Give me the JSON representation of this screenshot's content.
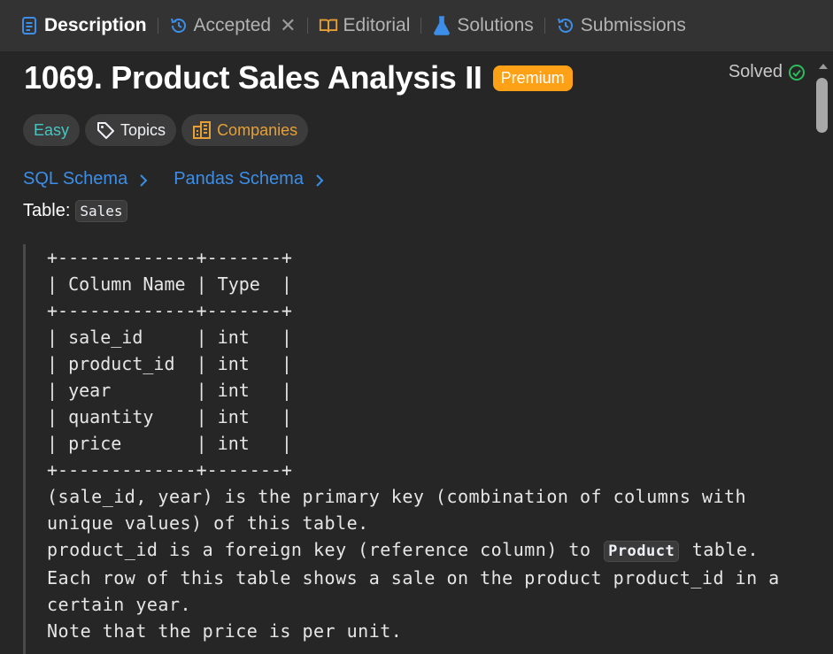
{
  "tabs": [
    {
      "label": "Description",
      "icon": "document-icon",
      "active": true
    },
    {
      "label": "Accepted",
      "icon": "history-icon",
      "closable": true
    },
    {
      "label": "Editorial",
      "icon": "book-icon"
    },
    {
      "label": "Solutions",
      "icon": "flask-icon"
    },
    {
      "label": "Submissions",
      "icon": "history-icon"
    }
  ],
  "problem": {
    "title": "1069. Product Sales Analysis II",
    "badge": "Premium",
    "status": "Solved"
  },
  "chips": {
    "difficulty": "Easy",
    "topics": "Topics",
    "companies": "Companies"
  },
  "schema_links": {
    "sql": "SQL Schema",
    "pandas": "Pandas Schema"
  },
  "table_label": "Table:",
  "table_name": "Sales",
  "schema_table": {
    "border": "+-------------+-------+",
    "header": "| Column Name | Type  |",
    "rows": [
      "| sale_id     | int   |",
      "| product_id  | int   |",
      "| year        | int   |",
      "| quantity    | int   |",
      "| price       | int   |"
    ]
  },
  "notes": {
    "line1": "(sale_id, year) is the primary key (combination of columns with unique values) of this table.",
    "line2_pre": "product_id is a foreign key (reference column) to ",
    "line2_code": "Product",
    "line2_post": " table.",
    "line3": "Each row of this table shows a sale on the product product_id in a certain year.",
    "line4": "Note that the price is per unit."
  },
  "colors": {
    "accent_blue": "#3c8ee8",
    "premium": "#ffa116",
    "easy": "#46c6c2",
    "companies": "#e7a035",
    "solved_check": "#2cbb5d"
  }
}
